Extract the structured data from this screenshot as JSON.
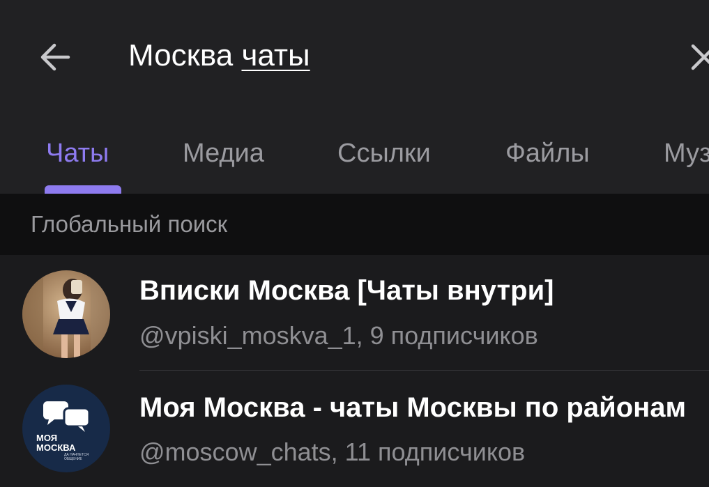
{
  "search": {
    "query_word1": "Москва",
    "query_word2": "чаты"
  },
  "tabs": [
    {
      "label": "Чаты",
      "active": true
    },
    {
      "label": "Медиа"
    },
    {
      "label": "Ссылки"
    },
    {
      "label": "Файлы"
    },
    {
      "label": "Муз"
    }
  ],
  "section": {
    "title": "Глобальный поиск"
  },
  "results": [
    {
      "title": "Вписки Москва [Чаты внутри]",
      "subtitle": "@vpiski_moskva_1, 9 подписчиков"
    },
    {
      "title": "Моя Москва - чаты Москвы по районам",
      "subtitle": "@moscow_chats, 11 подписчиков",
      "avatar_text_1": "МОЯ",
      "avatar_text_2": "МОСКВА",
      "avatar_text_small": "ДА НАЧНЕТСЯ ОБЩЕНИЕ"
    }
  ],
  "colors": {
    "accent": "#8e7bef",
    "background": "#1b1b1d",
    "header": "#212123"
  },
  "icons": {
    "back": "arrow-left-icon",
    "clear": "close-icon"
  }
}
